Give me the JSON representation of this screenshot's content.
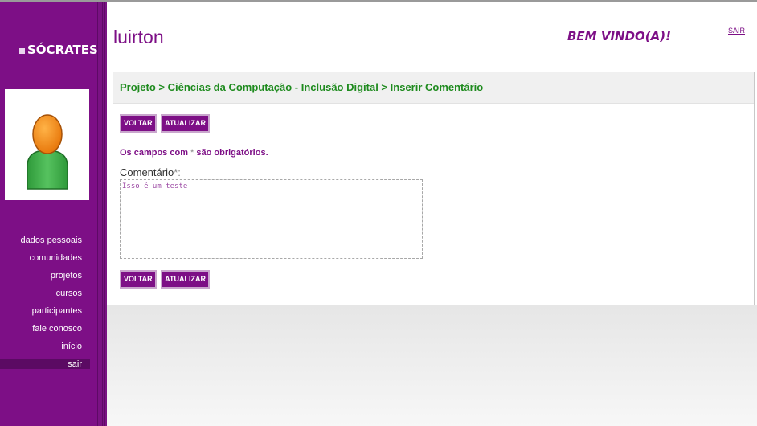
{
  "sidebar": {
    "logo": "SÓCRATES",
    "items": [
      {
        "label": "dados pessoais"
      },
      {
        "label": "comunidades"
      },
      {
        "label": "projetos"
      },
      {
        "label": "cursos"
      },
      {
        "label": "participantes"
      },
      {
        "label": "fale conosco"
      },
      {
        "label": "início"
      },
      {
        "label": "sair"
      }
    ]
  },
  "header": {
    "username": "luirton",
    "welcome": "BEM VINDO(A)!",
    "logout": "SAIR"
  },
  "main": {
    "breadcrumb": "Projeto > Ciências da Computação - Inclusão Digital > Inserir Comentário",
    "buttons": {
      "back": "VOLTAR",
      "update": "ATUALIZAR"
    },
    "required_note_prefix": "Os campos com ",
    "required_asterisk": "*",
    "required_note_suffix": " são obrigatórios.",
    "comment_label": "Comentário",
    "comment_label_asterisk": "*:",
    "comment_value": "Isso é um teste"
  },
  "colors": {
    "brand": "#7d0f86",
    "breadcrumb": "#1f8b1f"
  }
}
